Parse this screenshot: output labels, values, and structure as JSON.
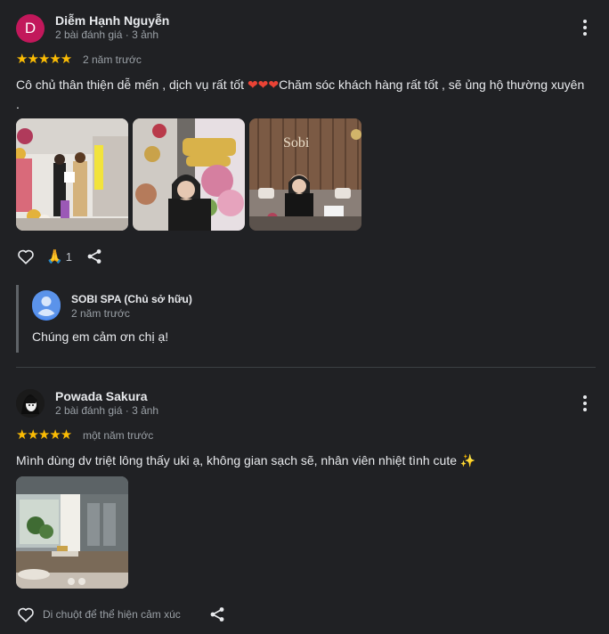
{
  "reviews": [
    {
      "author": "Diễm Hạnh Nguyễn",
      "avatar_letter": "D",
      "avatar_color": "#c2185b",
      "meta": "2 bài đánh giá · 3 ảnh",
      "stars": "★★★★★",
      "time": "2 năm trước",
      "text_part1": "Cô chủ thân thiện dễ mến , dịch vụ rất tốt ",
      "text_hearts": "❤❤❤",
      "text_part2": "Chăm sóc khách hàng rất tốt , sẽ ủng hộ thường xuyên .",
      "reaction_emoji": "🙏",
      "reaction_count": "1",
      "reply": {
        "owner": "SOBI SPA (Chủ sở hữu)",
        "time": "2 năm trước",
        "text": "Chúng em cảm ơn chị ạ!"
      }
    },
    {
      "author": "Powada Sakura",
      "meta": "2 bài đánh giá · 3 ảnh",
      "stars": "★★★★★",
      "time": "một năm trước",
      "text": "Mình dùng dv triệt lông thấy uki ạ, không gian sạch sẽ, nhân viên nhiệt tình cute ✨",
      "like_hint": "Di chuột để thể hiện cảm xúc"
    }
  ],
  "colors": {
    "star": "#fbbc04",
    "background": "#202124",
    "muted": "#9aa0a6"
  },
  "icons": [
    "more-vert-icon",
    "heart-outline-icon",
    "share-icon",
    "person-icon"
  ]
}
